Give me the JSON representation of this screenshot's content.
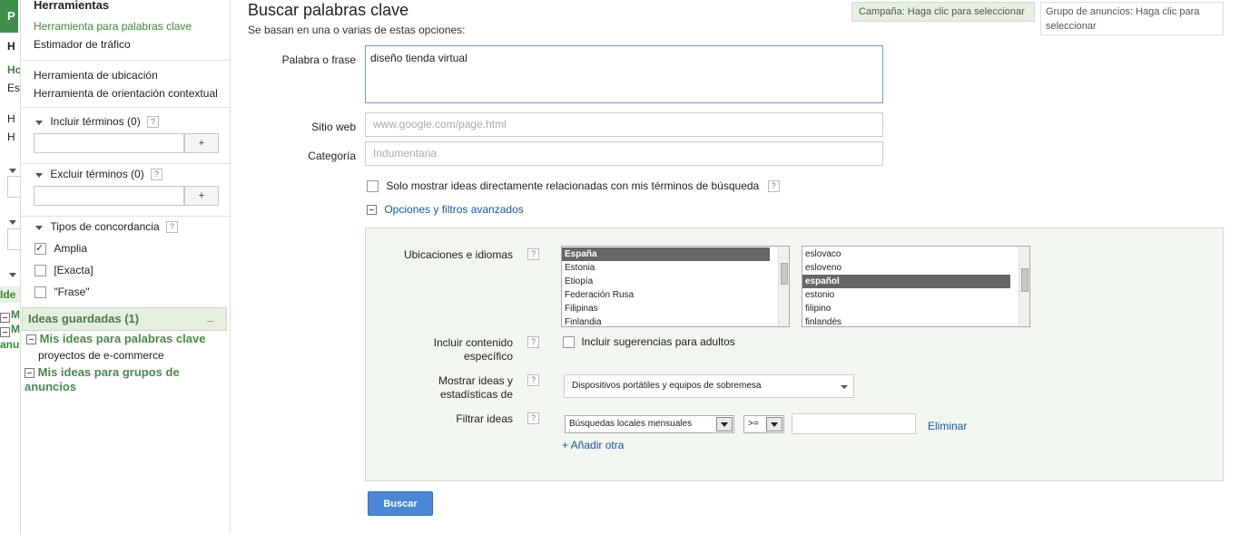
{
  "left_clipped": {
    "logo": "P",
    "items": [
      "H",
      "Hc",
      "Es",
      "H",
      "H",
      "Ide",
      "M",
      "M",
      "anu"
    ]
  },
  "sidebar": {
    "section_title": "Herramientas",
    "tools": [
      {
        "label": "Herramienta para palabras clave",
        "active": true
      },
      {
        "label": "Estimador de tráfico",
        "active": false
      },
      {
        "label": "Herramienta de ubicación",
        "active": false
      },
      {
        "label": "Herramienta de orientación contextual",
        "active": false
      }
    ],
    "include_terms": {
      "label": "Incluir términos (0)",
      "help": "?",
      "add": "+"
    },
    "exclude_terms": {
      "label": "Excluir términos (0)",
      "help": "?",
      "add": "+"
    },
    "match_types": {
      "label": "Tipos de concordancia",
      "help": "?",
      "options": [
        {
          "label": "Amplia",
          "checked": true
        },
        {
          "label": "[Exacta]",
          "checked": false
        },
        {
          "label": "\"Frase\"",
          "checked": false
        }
      ]
    },
    "saved_ideas": {
      "title": "Ideas guardadas (1)",
      "collapse": "_",
      "keyword_group": "Mis ideas para palabras clave",
      "keyword_item": "proyectos de e-commerce",
      "adgroup_group": "Mis ideas para grupos de anuncios"
    }
  },
  "header": {
    "title": "Buscar palabras clave",
    "subtitle": "Se basan en una o varias de estas opciones:",
    "campaign_label": "Campaña: Haga clic para seleccionar",
    "adgroup_label": "Grupo de anuncios: Haga clic para seleccionar"
  },
  "form": {
    "word_label": "Palabra o frase",
    "word_value": "diseño tienda virtual",
    "site_label": "Sitio web",
    "site_placeholder": "www.google.com/page.html",
    "category_label": "Categoría",
    "category_placeholder": "Indumentaria",
    "only_related_label": "Solo mostrar ideas directamente relacionadas con mis términos de búsqueda",
    "help": "?",
    "advanced_link": "Opciones y filtros avanzados"
  },
  "advanced": {
    "locations_label": "Ubicaciones e idiomas",
    "locations": [
      {
        "label": "España",
        "selected": true
      },
      {
        "label": "Estonia",
        "selected": false
      },
      {
        "label": "Etiopía",
        "selected": false
      },
      {
        "label": "Federación Rusa",
        "selected": false
      },
      {
        "label": "Filipinas",
        "selected": false
      },
      {
        "label": "Finlandia",
        "selected": false
      }
    ],
    "languages": [
      {
        "label": "eslovaco",
        "selected": false
      },
      {
        "label": "esloveno",
        "selected": false
      },
      {
        "label": "español",
        "selected": true
      },
      {
        "label": "estonio",
        "selected": false
      },
      {
        "label": "filipino",
        "selected": false
      },
      {
        "label": "finlandés",
        "selected": false
      }
    ],
    "content_label_1": "Incluir contenido",
    "content_label_2": "específico",
    "adult_label": "Incluir sugerencias para adultos",
    "show_label_1": "Mostrar ideas y",
    "show_label_2": "estadísticas de",
    "devices_value": "Dispositivos portátiles y equipos de sobremesa",
    "filter_label": "Filtrar ideas",
    "filter_metric": "Búsquedas locales mensuales",
    "filter_operator": ">=",
    "filter_value": "",
    "remove_link": "Eliminar",
    "add_link": "+ Añadir otra"
  },
  "search_button": "Buscar"
}
